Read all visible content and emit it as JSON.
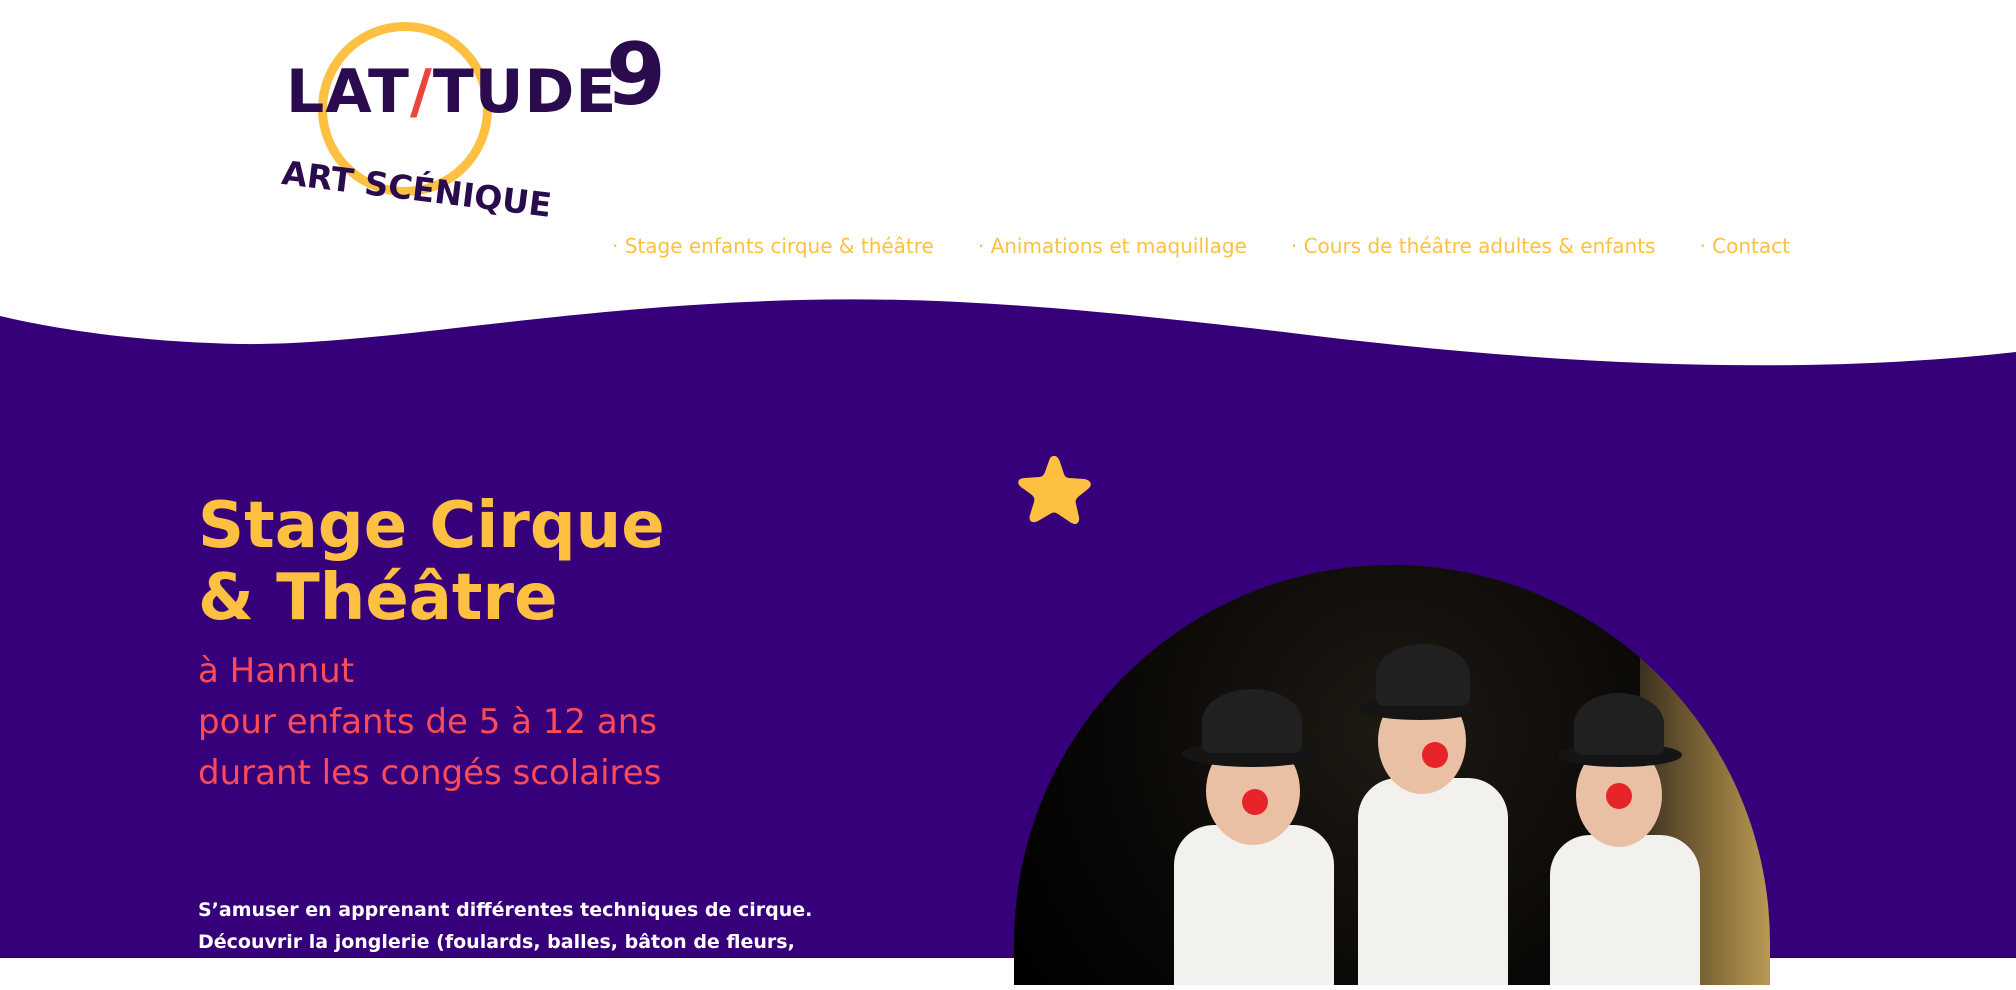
{
  "brand": {
    "name_left": "LAT",
    "name_slash": "/",
    "name_right": "TUDE",
    "number": "9",
    "tagline": "ART SCÉNIQUE"
  },
  "nav": {
    "items": [
      {
        "label": "· Stage enfants cirque & théâtre"
      },
      {
        "label": "· Animations et maquillage"
      },
      {
        "label": "· Cours de théâtre adultes & enfants"
      },
      {
        "label": "· Contact"
      }
    ]
  },
  "hero": {
    "title_line1": "Stage Cirque",
    "title_line2": "& Théâtre",
    "subtitle_line1": "à Hannut",
    "subtitle_line2": "pour enfants de 5 à 12 ans",
    "subtitle_line3": "durant les congés scolaires",
    "body_line1": "S’amuser en apprenant différentes techniques de cirque.",
    "body_line2": "Découvrir la jonglerie (foulards, balles, bâton de fleurs, bolas). Travailler"
  },
  "colors": {
    "purple": "#36007a",
    "yellow": "#fdc040",
    "coral": "#ff4b55",
    "logo_dark": "#2a0b4e"
  },
  "icons": {
    "star": "star-icon"
  }
}
